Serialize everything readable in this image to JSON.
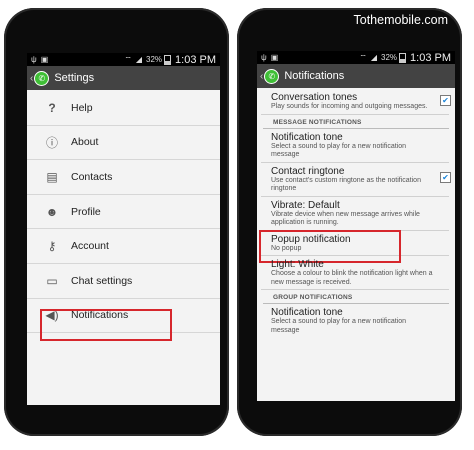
{
  "watermark": "Tothemobile.com",
  "status": {
    "battery": "32%",
    "time": "1:03 PM"
  },
  "left": {
    "title": "Settings",
    "items": [
      {
        "label": "Help",
        "icon": "question-icon"
      },
      {
        "label": "About",
        "icon": "info-icon"
      },
      {
        "label": "Contacts",
        "icon": "contacts-icon"
      },
      {
        "label": "Profile",
        "icon": "profile-icon"
      },
      {
        "label": "Account",
        "icon": "key-icon"
      },
      {
        "label": "Chat settings",
        "icon": "chat-icon"
      },
      {
        "label": "Notifications",
        "icon": "speaker-icon"
      }
    ]
  },
  "right": {
    "title": "Notifications",
    "conv_title": "Conversation tones",
    "conv_sub": "Play sounds for incoming and outgoing messages.",
    "section_message": "MESSAGE NOTIFICATIONS",
    "ntone_title": "Notification tone",
    "ntone_sub": "Select a sound to play for a new notification message",
    "cring_title": "Contact ringtone",
    "cring_sub": "Use contact's custom ringtone as the notification ringtone",
    "vib_title": "Vibrate: Default",
    "vib_sub": "Vibrate device when new message arrives while application is running.",
    "popup_title": "Popup notification",
    "popup_sub": "No popup",
    "light_title": "Light: White",
    "light_sub": "Choose a colour to blink the notification light when a new message is received.",
    "section_group": "GROUP NOTIFICATIONS",
    "gtone_title": "Notification tone",
    "gtone_sub": "Select a sound to play for a new notification message"
  },
  "colors": {
    "highlight": "#d6262c",
    "whatsapp": "#3fbf36",
    "checkbox": "#1a84d8"
  }
}
